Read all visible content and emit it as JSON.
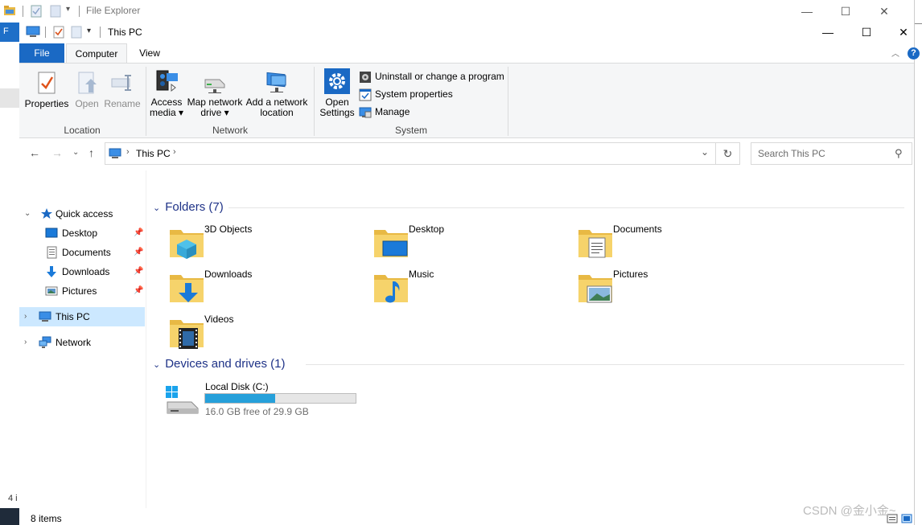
{
  "background_window": {
    "title": "File Explorer",
    "file_tab_letter": "F",
    "left_numbers": "4 i"
  },
  "window": {
    "title": "This PC",
    "controls": {
      "minimize": "—",
      "maximize": "☐",
      "close": "✕"
    }
  },
  "tabs": [
    {
      "label": "File"
    },
    {
      "label": "Computer"
    },
    {
      "label": "View"
    }
  ],
  "ribbon": {
    "location": {
      "label": "Location",
      "properties": "Properties",
      "open": "Open",
      "rename": "Rename"
    },
    "network": {
      "label": "Network",
      "access_media_1": "Access",
      "access_media_2": "media ▾",
      "map_drive_1": "Map network",
      "map_drive_2": "drive ▾",
      "add_location_1": "Add a network",
      "add_location_2": "location"
    },
    "system": {
      "label": "System",
      "open_settings_1": "Open",
      "open_settings_2": "Settings",
      "uninstall": "Uninstall or change a program",
      "system_properties": "System properties",
      "manage": "Manage"
    }
  },
  "address": {
    "path": "This PC",
    "search_placeholder": "Search This PC"
  },
  "nav": {
    "quick_access": "Quick access",
    "desktop": "Desktop",
    "documents": "Documents",
    "downloads": "Downloads",
    "pictures": "Pictures",
    "this_pc": "This PC",
    "network": "Network"
  },
  "content": {
    "folders_header": "Folders (7)",
    "folders": [
      "3D Objects",
      "Desktop",
      "Documents",
      "Downloads",
      "Music",
      "Pictures",
      "Videos"
    ],
    "devices_header": "Devices and drives (1)",
    "drive": {
      "name": "Local Disk (C:)",
      "free_text": "16.0 GB free of 29.9 GB",
      "used_fraction": 0.465
    }
  },
  "status": {
    "items": "8 items"
  },
  "watermark": "CSDN @金小金~",
  "colors": {
    "accent": "#1a69c4",
    "selection": "#cce8ff",
    "section_header": "#1e3287",
    "drive_bar": "#26a0da"
  }
}
